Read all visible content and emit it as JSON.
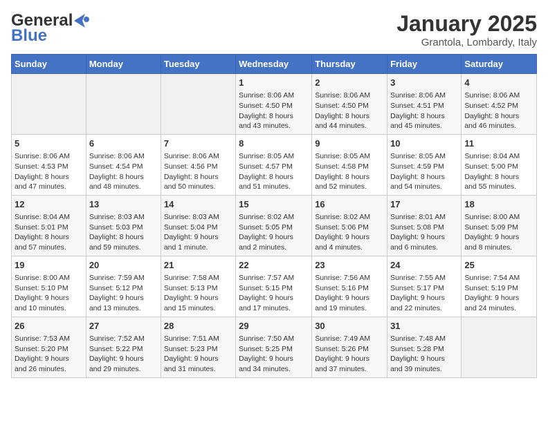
{
  "header": {
    "logo_line1": "General",
    "logo_line2": "Blue",
    "month": "January 2025",
    "location": "Grantola, Lombardy, Italy"
  },
  "weekdays": [
    "Sunday",
    "Monday",
    "Tuesday",
    "Wednesday",
    "Thursday",
    "Friday",
    "Saturday"
  ],
  "weeks": [
    [
      {
        "day": "",
        "info": ""
      },
      {
        "day": "",
        "info": ""
      },
      {
        "day": "",
        "info": ""
      },
      {
        "day": "1",
        "info": "Sunrise: 8:06 AM\nSunset: 4:50 PM\nDaylight: 8 hours\nand 43 minutes."
      },
      {
        "day": "2",
        "info": "Sunrise: 8:06 AM\nSunset: 4:50 PM\nDaylight: 8 hours\nand 44 minutes."
      },
      {
        "day": "3",
        "info": "Sunrise: 8:06 AM\nSunset: 4:51 PM\nDaylight: 8 hours\nand 45 minutes."
      },
      {
        "day": "4",
        "info": "Sunrise: 8:06 AM\nSunset: 4:52 PM\nDaylight: 8 hours\nand 46 minutes."
      }
    ],
    [
      {
        "day": "5",
        "info": "Sunrise: 8:06 AM\nSunset: 4:53 PM\nDaylight: 8 hours\nand 47 minutes."
      },
      {
        "day": "6",
        "info": "Sunrise: 8:06 AM\nSunset: 4:54 PM\nDaylight: 8 hours\nand 48 minutes."
      },
      {
        "day": "7",
        "info": "Sunrise: 8:06 AM\nSunset: 4:56 PM\nDaylight: 8 hours\nand 50 minutes."
      },
      {
        "day": "8",
        "info": "Sunrise: 8:05 AM\nSunset: 4:57 PM\nDaylight: 8 hours\nand 51 minutes."
      },
      {
        "day": "9",
        "info": "Sunrise: 8:05 AM\nSunset: 4:58 PM\nDaylight: 8 hours\nand 52 minutes."
      },
      {
        "day": "10",
        "info": "Sunrise: 8:05 AM\nSunset: 4:59 PM\nDaylight: 8 hours\nand 54 minutes."
      },
      {
        "day": "11",
        "info": "Sunrise: 8:04 AM\nSunset: 5:00 PM\nDaylight: 8 hours\nand 55 minutes."
      }
    ],
    [
      {
        "day": "12",
        "info": "Sunrise: 8:04 AM\nSunset: 5:01 PM\nDaylight: 8 hours\nand 57 minutes."
      },
      {
        "day": "13",
        "info": "Sunrise: 8:03 AM\nSunset: 5:03 PM\nDaylight: 8 hours\nand 59 minutes."
      },
      {
        "day": "14",
        "info": "Sunrise: 8:03 AM\nSunset: 5:04 PM\nDaylight: 9 hours\nand 1 minute."
      },
      {
        "day": "15",
        "info": "Sunrise: 8:02 AM\nSunset: 5:05 PM\nDaylight: 9 hours\nand 2 minutes."
      },
      {
        "day": "16",
        "info": "Sunrise: 8:02 AM\nSunset: 5:06 PM\nDaylight: 9 hours\nand 4 minutes."
      },
      {
        "day": "17",
        "info": "Sunrise: 8:01 AM\nSunset: 5:08 PM\nDaylight: 9 hours\nand 6 minutes."
      },
      {
        "day": "18",
        "info": "Sunrise: 8:00 AM\nSunset: 5:09 PM\nDaylight: 9 hours\nand 8 minutes."
      }
    ],
    [
      {
        "day": "19",
        "info": "Sunrise: 8:00 AM\nSunset: 5:10 PM\nDaylight: 9 hours\nand 10 minutes."
      },
      {
        "day": "20",
        "info": "Sunrise: 7:59 AM\nSunset: 5:12 PM\nDaylight: 9 hours\nand 13 minutes."
      },
      {
        "day": "21",
        "info": "Sunrise: 7:58 AM\nSunset: 5:13 PM\nDaylight: 9 hours\nand 15 minutes."
      },
      {
        "day": "22",
        "info": "Sunrise: 7:57 AM\nSunset: 5:15 PM\nDaylight: 9 hours\nand 17 minutes."
      },
      {
        "day": "23",
        "info": "Sunrise: 7:56 AM\nSunset: 5:16 PM\nDaylight: 9 hours\nand 19 minutes."
      },
      {
        "day": "24",
        "info": "Sunrise: 7:55 AM\nSunset: 5:17 PM\nDaylight: 9 hours\nand 22 minutes."
      },
      {
        "day": "25",
        "info": "Sunrise: 7:54 AM\nSunset: 5:19 PM\nDaylight: 9 hours\nand 24 minutes."
      }
    ],
    [
      {
        "day": "26",
        "info": "Sunrise: 7:53 AM\nSunset: 5:20 PM\nDaylight: 9 hours\nand 26 minutes."
      },
      {
        "day": "27",
        "info": "Sunrise: 7:52 AM\nSunset: 5:22 PM\nDaylight: 9 hours\nand 29 minutes."
      },
      {
        "day": "28",
        "info": "Sunrise: 7:51 AM\nSunset: 5:23 PM\nDaylight: 9 hours\nand 31 minutes."
      },
      {
        "day": "29",
        "info": "Sunrise: 7:50 AM\nSunset: 5:25 PM\nDaylight: 9 hours\nand 34 minutes."
      },
      {
        "day": "30",
        "info": "Sunrise: 7:49 AM\nSunset: 5:26 PM\nDaylight: 9 hours\nand 37 minutes."
      },
      {
        "day": "31",
        "info": "Sunrise: 7:48 AM\nSunset: 5:28 PM\nDaylight: 9 hours\nand 39 minutes."
      },
      {
        "day": "",
        "info": ""
      }
    ]
  ]
}
